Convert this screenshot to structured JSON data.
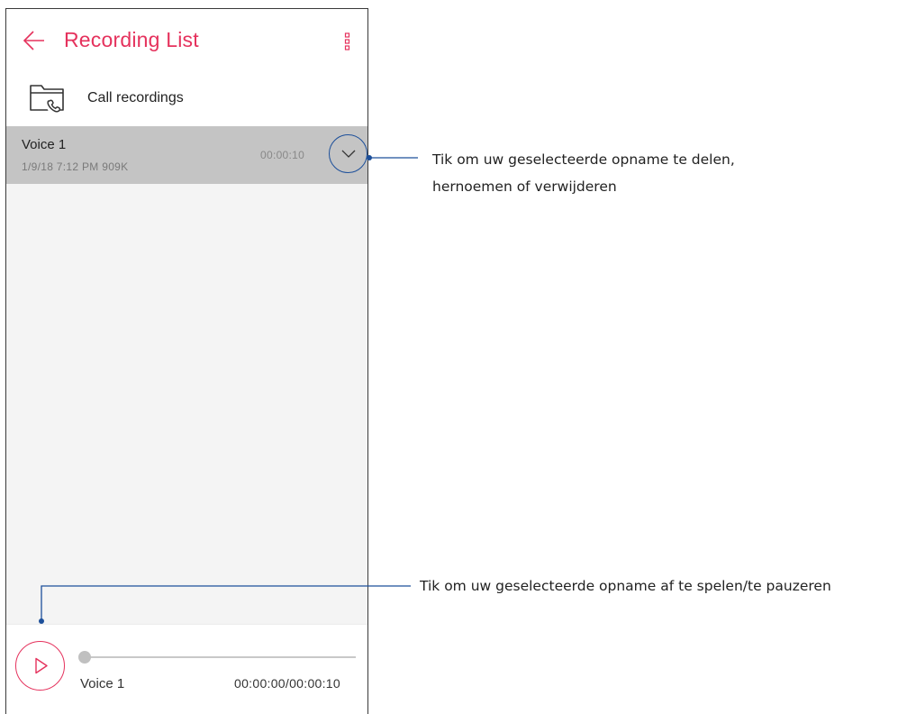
{
  "header": {
    "title": "Recording List",
    "back_icon": "arrow-left-icon",
    "more_icon": "more-vertical-icon"
  },
  "folder": {
    "label": "Call recordings",
    "icon": "folder-phone-icon"
  },
  "recordings": [
    {
      "name": "Voice 1",
      "date": "1/9/18 7:12 PM",
      "size": "909K",
      "duration": "00:00:10",
      "selected": true
    }
  ],
  "player": {
    "name": "Voice 1",
    "time": "00:00:00/00:00:10",
    "progress": 0
  },
  "callouts": {
    "expand_line1": "Tik om uw geselecteerde opname te delen,",
    "expand_line2": "hernoemen of verwijderen",
    "play": "Tik om uw geselecteerde opname af te spelen/te pauzeren"
  },
  "colors": {
    "accent": "#e5325d",
    "callout": "#1c4f9a",
    "selected_row": "#c4c4c4",
    "list_background": "#f4f4f4"
  }
}
